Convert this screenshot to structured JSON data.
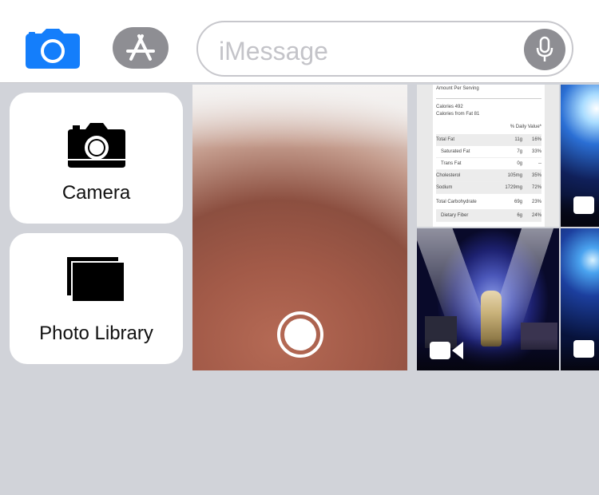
{
  "compose_bar": {
    "placeholder": "iMessage",
    "camera_icon": "camera-icon",
    "appstore_icon": "app-store-icon",
    "mic_icon": "microphone-icon",
    "accent_color": "#147efb"
  },
  "panel": {
    "camera_label": "Camera",
    "library_label": "Photo Library"
  },
  "nutrition": {
    "header": "Amount Per Serving",
    "calories": "Calories 492",
    "calories_fat": "Calories from Fat 81",
    "dv_header": "% Daily Value*",
    "rows": [
      {
        "name": "Total Fat",
        "amount": "11g",
        "dv": "16%"
      },
      {
        "name": "Saturated Fat",
        "amount": "7g",
        "dv": "33%"
      },
      {
        "name": "Trans Fat",
        "amount": "0g",
        "dv": "--"
      },
      {
        "name": "Cholesterol",
        "amount": "105mg",
        "dv": "35%"
      },
      {
        "name": "Sodium",
        "amount": "1729mg",
        "dv": "72%"
      },
      {
        "name": "Total Carbohydrate",
        "amount": "69g",
        "dv": "23%"
      },
      {
        "name": "Dietary Fiber",
        "amount": "6g",
        "dv": "24%"
      }
    ]
  }
}
